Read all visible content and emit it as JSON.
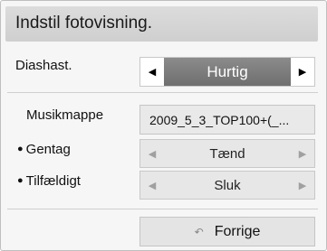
{
  "title": "Indstil fotovisning.",
  "slideshow_speed": {
    "label": "Diashast.",
    "value": "Hurtig"
  },
  "music_folder": {
    "label": "Musikmappe",
    "value": "2009_5_3_TOP100+(_..."
  },
  "repeat": {
    "label": "Gentag",
    "value": "Tænd"
  },
  "shuffle": {
    "label": "Tilfældigt",
    "value": "Sluk"
  },
  "back_button": {
    "label": "Forrige"
  },
  "icons": {
    "left": "◀",
    "right": "▶",
    "bullet": "●",
    "back": "↶"
  },
  "colors": {
    "selected_value_bg": "#7d7d7d",
    "panel_bg": "#f6f6f6",
    "title_bg": "#d6d6d6"
  }
}
